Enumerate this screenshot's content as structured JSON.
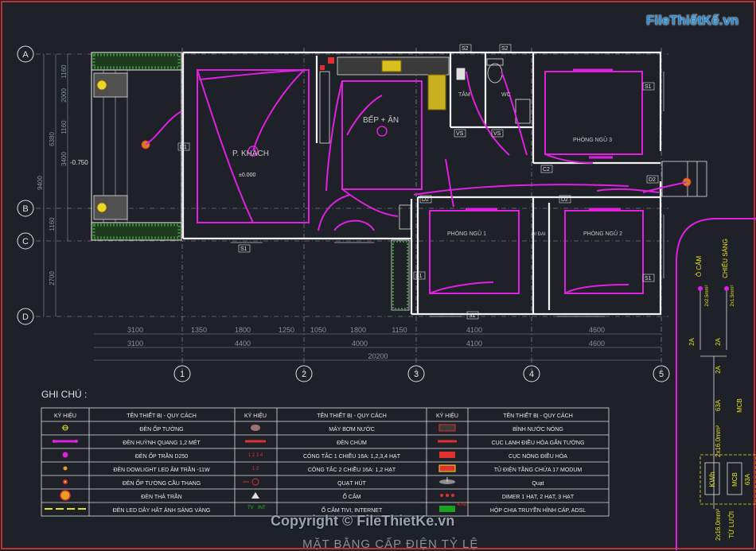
{
  "brand": "FileThiếtKế.vn",
  "copyright": "Copyright © FileThietKe.vn",
  "bottom_title": "MẶT BẰNG CẤP ĐIỆN        TỶ LỆ",
  "grid_letters": [
    "A",
    "B",
    "C",
    "D"
  ],
  "grid_numbers": [
    "1",
    "2",
    "3",
    "4",
    "5"
  ],
  "rooms": {
    "living": "P. KHÁCH",
    "kitchen": "BẾP + ĂN",
    "bath": "TẮM",
    "wc": "WC",
    "bed3": "PHÒNG NGỦ 3",
    "bed1": "PHÒNG NGỦ 1",
    "bed2": "PHÒNG NGỦ 2",
    "closet": "ĐI ĐẠI",
    "level": "±0.000",
    "level2": "-0.750"
  },
  "dims_top_row": [
    "3100",
    "1350",
    "1800",
    "1250",
    "1050",
    "1800",
    "1150",
    "4100",
    "4600"
  ],
  "dims_mid_row": [
    "3100",
    "4400",
    "4000",
    "4100",
    "4600"
  ],
  "dim_total": "20200",
  "dims_left": [
    "1160",
    "2000",
    "1160",
    "6380",
    "3400",
    "9400",
    "1160",
    "2700"
  ],
  "door_tags": [
    "D1",
    "D2",
    "D2",
    "D2",
    "S1",
    "S1",
    "S1",
    "S1",
    "S1",
    "S2",
    "S2",
    "VS",
    "VS",
    "C2"
  ],
  "panel": {
    "label_socket": "Ô CẮM",
    "label_light": "CHIẾU SÁNG",
    "breakers": [
      "2A",
      "2A",
      "2A",
      "63A",
      "2x16.0mm²",
      "KWh",
      "MCB",
      "63A",
      "2x16.0mm²",
      "TỪ LƯỚI"
    ],
    "cables": [
      "2x2.5mm²",
      "2x1.5mm²"
    ]
  },
  "legend": {
    "title": "GHI CHÚ :",
    "headers": [
      "KÝ HIỆU",
      "TÊN THIẾT BỊ - QUY CÁCH",
      "KÝ HIỆU",
      "TÊN THIẾT BỊ - QUY CÁCH",
      "KÝ HIỆU",
      "TÊN THIẾT BỊ - QUY CÁCH"
    ],
    "rows": [
      [
        "ĐÈN ỐP TƯỜNG",
        "MÁY BƠM NƯỚC",
        "BÌNH NƯỚC NÓNG"
      ],
      [
        "ĐÈN HUỲNH QUANG 1,2 MÉT",
        "ĐÈN CHÙM",
        "CỤC LẠNH ĐIỀU HÒA GẮN TƯỜNG"
      ],
      [
        "ĐÈN ỐP TRẦN D250",
        "CÔNG TẮC 1 CHIỀU 16A: 1,2,3,4 HẠT",
        "CỤC NÓNG ĐIỀU HÒA"
      ],
      [
        "ĐÈN DOWLIGHT LED ÂM TRẦN -11W",
        "CÔNG TẮC 2 CHIỀU 16A: 1,2 HẠT",
        "TỦ ĐIỆN TẦNG CHỨA 17 MODUM"
      ],
      [
        "ĐÈN ỐP TƯỜNG CẦU THANG",
        "QUẠT HÚT",
        "Quạt"
      ],
      [
        "ĐÈN THẢ TRẦN",
        "Ổ CẮM",
        "DIMER 1 HẠT, 2 HẠT, 3 HẠT"
      ],
      [
        "ĐÈN LED DÂY HẮT ÁNH SÁNG VÀNG",
        "Ổ CẮM TIVI, INTERNET",
        "HỘP CHIA TRUYỀN HÌNH CÁP,  ADSL"
      ]
    ],
    "symbol_texts": [
      "1 2 3 4",
      "1 2",
      "TV",
      "INT",
      "ADSL"
    ]
  },
  "colors": {
    "background": "#1e2128",
    "wall": "#f2f2f2",
    "wire": "#e020e0",
    "dim": "#8a8fa0",
    "grid_line": "#b0b0b0",
    "legend_text": "#e8e8e8",
    "hatch_green": "#3a8a3a",
    "yellow": "#e8e020",
    "red": "#e03030",
    "brand": "#1f8ad6"
  }
}
